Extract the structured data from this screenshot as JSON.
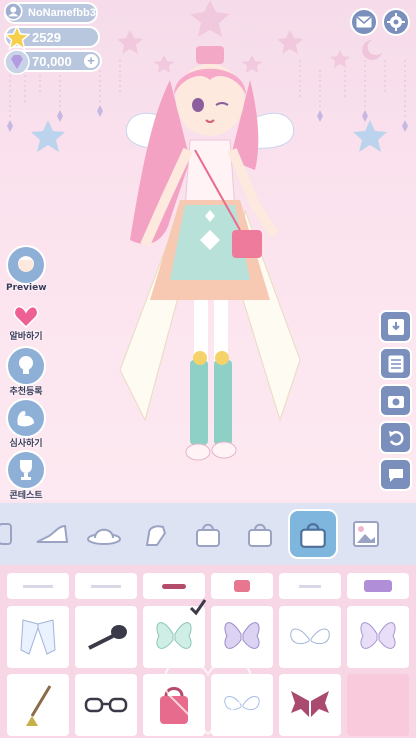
{
  "player": {
    "name": "NoNamefbb3",
    "stars": "2529",
    "gems": "70,000"
  },
  "top_buttons": {
    "mail": "mail-icon",
    "settings": "gear-icon"
  },
  "left_menu": [
    {
      "label": "Preview",
      "icon": "girl-portrait-icon"
    },
    {
      "label": "알바하기",
      "icon": "heart-icon"
    },
    {
      "label": "추천등록",
      "icon": "light-bulb-icon"
    },
    {
      "label": "심사하기",
      "icon": "muscle-icon"
    },
    {
      "label": "콘테스트",
      "icon": "trophy-icon"
    }
  ],
  "right_menu": [
    "save-icon",
    "list-icon",
    "camera-icon",
    "undo-icon",
    "chat-icon"
  ],
  "categories": [
    "partial-item-icon",
    "high-heel-icon",
    "hat-icon",
    "glove-icon",
    "handbag-icon",
    "handbag-icon",
    "handbag-icon",
    "background-icon"
  ],
  "active_category": 6,
  "grid_items": [
    "partial-item",
    "partial-item",
    "partial-item",
    "partial-item",
    "partial-item",
    "partial-item",
    "ribbon-wings",
    "microphone",
    "fairy-wings-green",
    "fairy-wings-purple",
    "angel-wings",
    "fairy-wings-lilac",
    "broom",
    "glasses",
    "pink-bag",
    "angel-wings-small",
    "bat-wings",
    "empty"
  ],
  "colors": {
    "accent": "#7eb6de",
    "button": "#7b8fbd",
    "stat_bg": "#b9c7de",
    "bar_bg": "#dde3f3",
    "grid_bg": "#f7d7e5"
  }
}
